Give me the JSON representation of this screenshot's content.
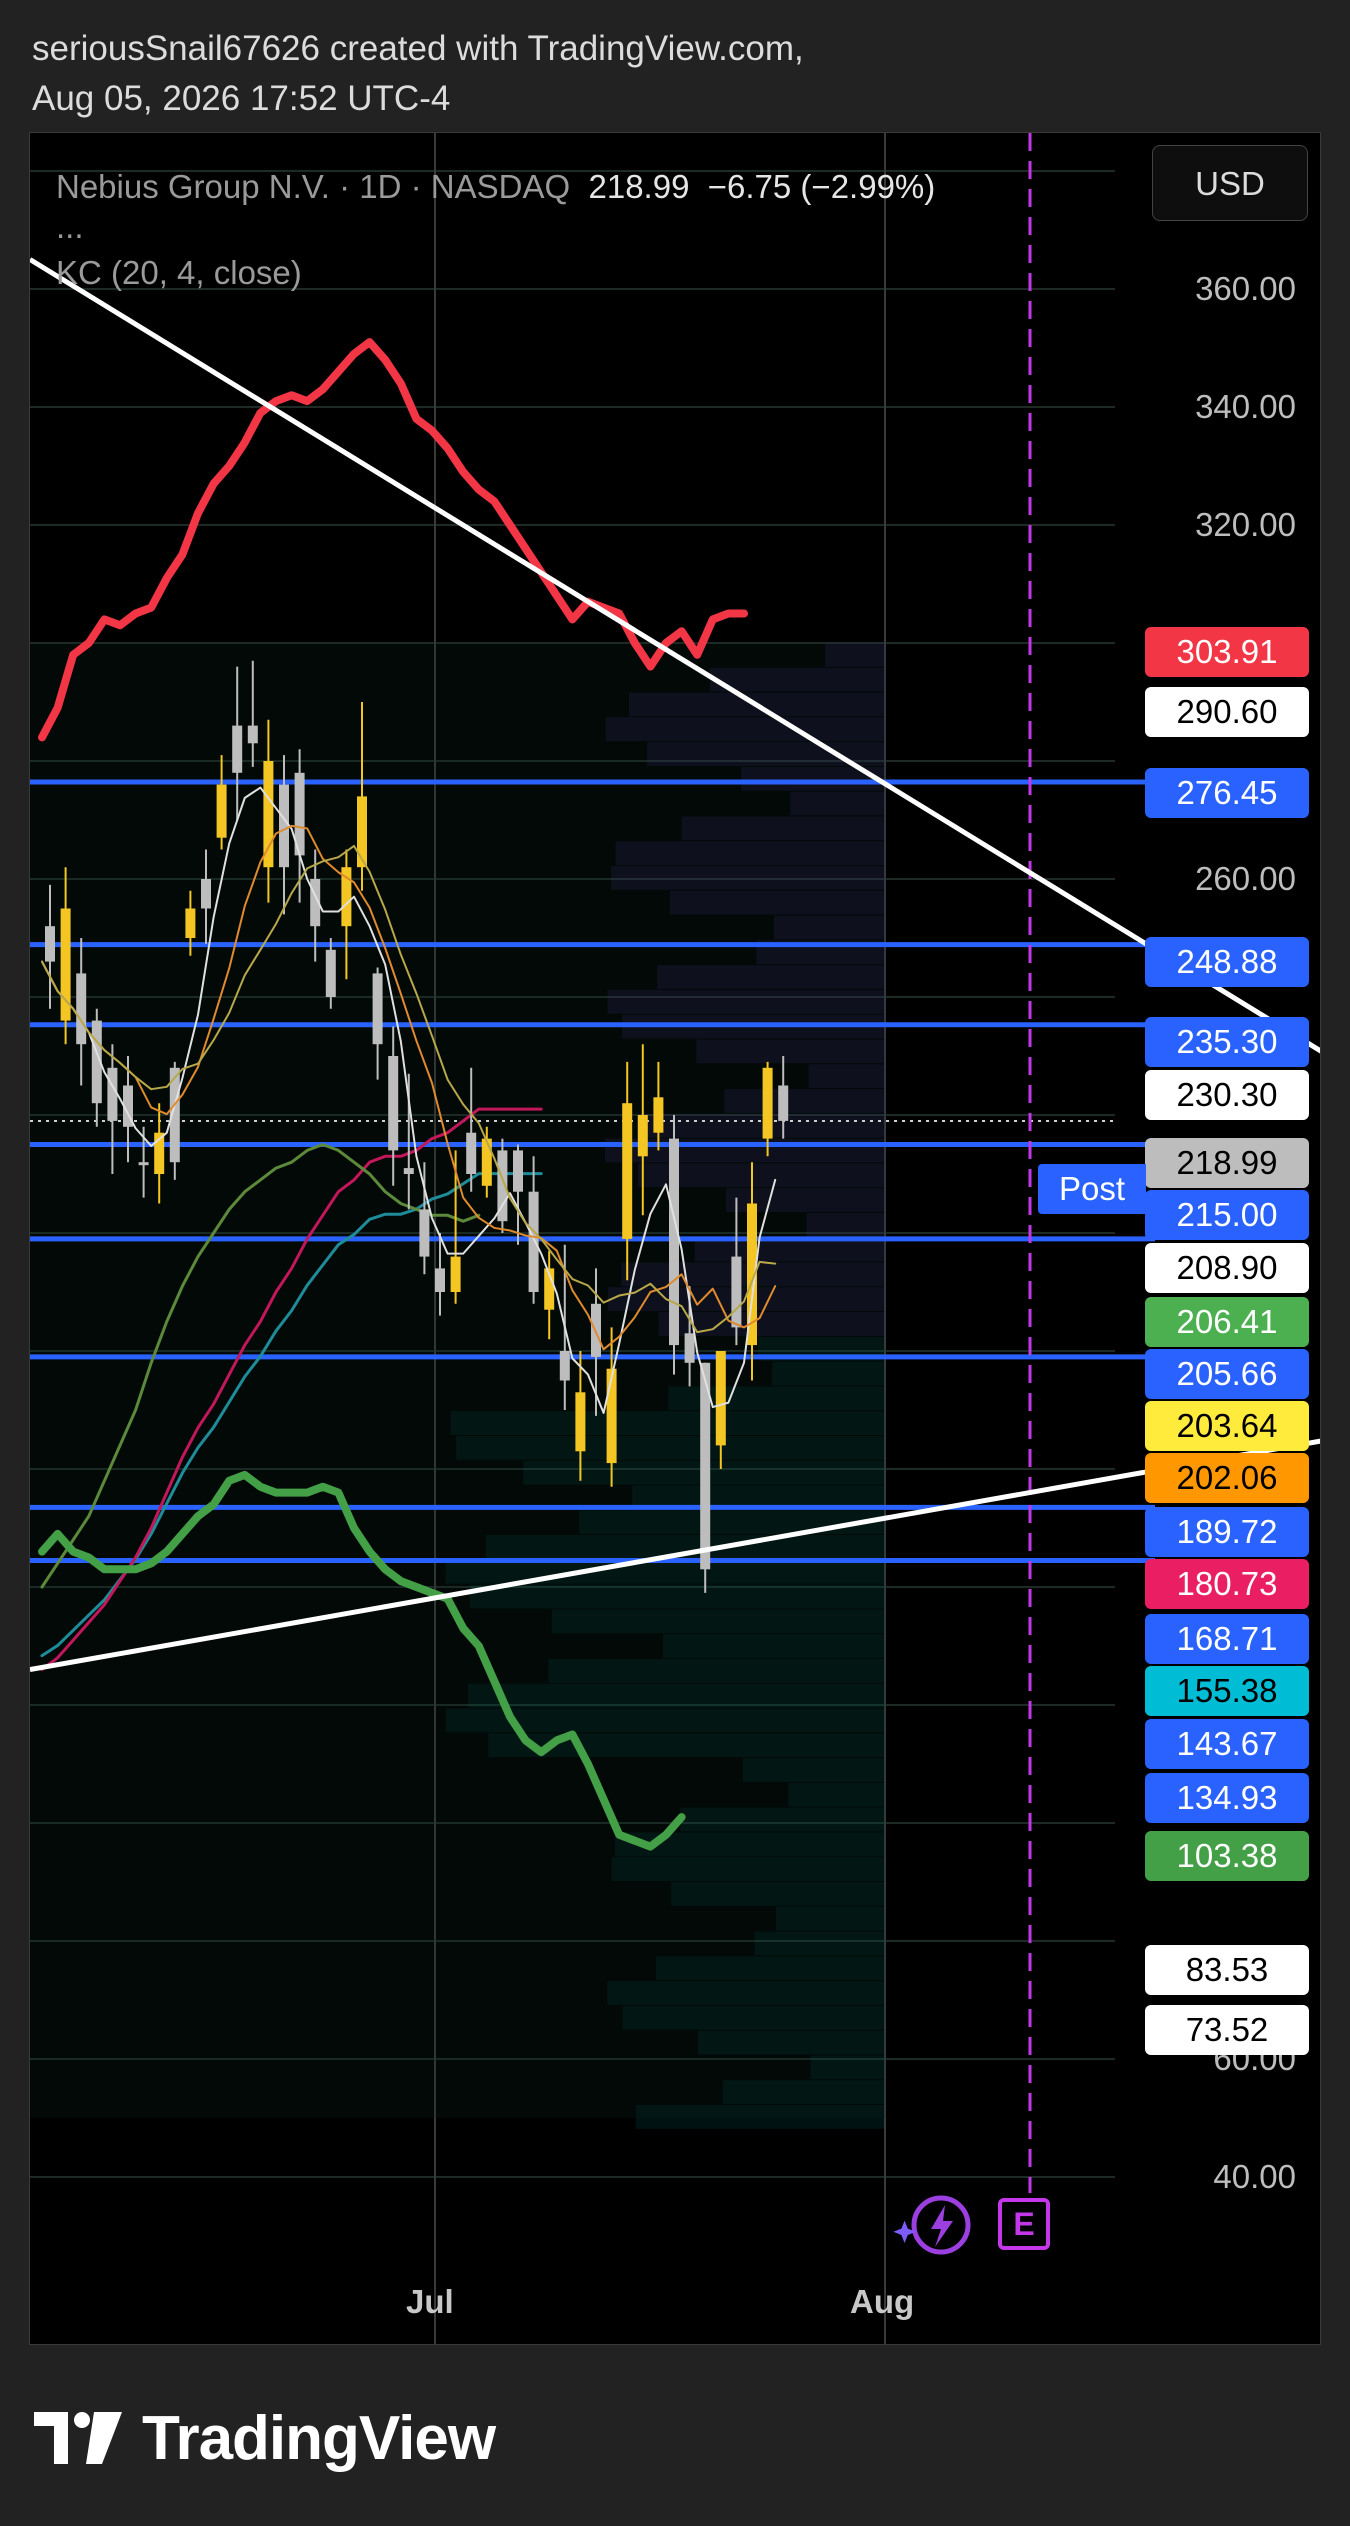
{
  "caption": {
    "line1": "seriousSnail67626 created with TradingView.com,",
    "line2": "Aug 05, 2026 17:52 UTC-4"
  },
  "header": {
    "symbol": "Nebius Group N.V. · 1D · NASDAQ",
    "price": "218.99",
    "change": "−6.75 (−2.99%)",
    "ellipsis": "...",
    "indicator": "KC (20, 4, close)",
    "currency": "USD"
  },
  "footer": {
    "brand": "TradingView"
  },
  "icons": {
    "lightning": "lightning-icon",
    "earnings": "earnings-icon",
    "logo": "tradingview-logo-icon"
  },
  "chart_data": {
    "type": "candlestick",
    "title": "",
    "ylim": [
      30,
      380
    ],
    "yticks": [
      "360.00",
      "340.00",
      "320.00",
      "260.00",
      "60.00",
      "40.00"
    ],
    "xticks": [
      "Jul",
      "Aug"
    ],
    "earnings_marker": "E",
    "post_label": "Post",
    "price_tags": [
      {
        "label": "303.91",
        "bg": "#f23645",
        "fg": "#ffffff"
      },
      {
        "label": "290.60",
        "bg": "#ffffff",
        "fg": "#000000"
      },
      {
        "label": "276.45",
        "bg": "#2962ff",
        "fg": "#ffffff"
      },
      {
        "label": "248.88",
        "bg": "#2962ff",
        "fg": "#ffffff"
      },
      {
        "label": "235.30",
        "bg": "#2962ff",
        "fg": "#ffffff"
      },
      {
        "label": "230.30",
        "bg": "#ffffff",
        "fg": "#000000"
      },
      {
        "label": "218.99",
        "bg": "#bdbdbd",
        "fg": "#000000"
      },
      {
        "label": "215.00",
        "bg": "#2962ff",
        "fg": "#ffffff"
      },
      {
        "label": "208.90",
        "bg": "#ffffff",
        "fg": "#000000"
      },
      {
        "label": "206.41",
        "bg": "#4caf50",
        "fg": "#ffffff"
      },
      {
        "label": "205.66",
        "bg": "#2962ff",
        "fg": "#ffffff"
      },
      {
        "label": "203.64",
        "bg": "#ffeb3b",
        "fg": "#000000"
      },
      {
        "label": "202.06",
        "bg": "#ff9800",
        "fg": "#000000"
      },
      {
        "label": "189.72",
        "bg": "#2962ff",
        "fg": "#ffffff"
      },
      {
        "label": "180.73",
        "bg": "#e91e63",
        "fg": "#ffffff"
      },
      {
        "label": "168.71",
        "bg": "#2962ff",
        "fg": "#ffffff"
      },
      {
        "label": "155.38",
        "bg": "#00bcd4",
        "fg": "#000000"
      },
      {
        "label": "143.67",
        "bg": "#2962ff",
        "fg": "#ffffff"
      },
      {
        "label": "134.93",
        "bg": "#2962ff",
        "fg": "#ffffff"
      },
      {
        "label": "103.38",
        "bg": "#43a047",
        "fg": "#ffffff"
      },
      {
        "label": "83.53",
        "bg": "#ffffff",
        "fg": "#000000"
      },
      {
        "label": "73.52",
        "bg": "#ffffff",
        "fg": "#000000"
      }
    ],
    "horizontal_levels": [
      276.45,
      248.88,
      235.3,
      215.0,
      199.0,
      179.0,
      153.5,
      144.5
    ],
    "last_price": 218.99,
    "post_price": 215.0,
    "trendlines": [
      {
        "from": [
          0,
          365
        ],
        "to": [
          112,
          178
        ]
      },
      {
        "from": [
          0,
          126
        ],
        "to": [
          112,
          180
        ]
      }
    ],
    "keltner_upper": [
      284,
      289,
      298,
      300,
      304,
      303,
      305,
      306,
      311,
      315,
      322,
      327,
      330,
      334,
      339,
      341,
      342,
      341,
      343,
      346,
      349,
      351,
      348,
      344,
      338,
      336,
      333,
      329,
      326,
      324,
      320,
      316,
      312,
      308,
      304,
      307,
      306,
      305,
      300,
      296,
      300,
      302,
      298,
      304,
      305,
      305
    ],
    "keltner_lower": [
      146,
      149,
      146,
      145,
      143,
      143,
      143,
      144,
      146,
      149,
      152,
      154,
      158,
      159,
      157,
      156,
      156,
      156,
      157,
      156,
      150,
      146,
      143,
      141,
      140,
      139,
      138,
      133,
      130,
      124,
      118,
      114,
      112,
      114,
      115,
      110,
      104,
      98,
      97,
      96,
      98,
      101
    ],
    "ema_slow": [
      126,
      128,
      131,
      134,
      137,
      141,
      145,
      150,
      156,
      162,
      167,
      171,
      176,
      181,
      185,
      190,
      194,
      199,
      203,
      207,
      209,
      212,
      213,
      213,
      214,
      216,
      217,
      219,
      221,
      221,
      221,
      221,
      221
    ],
    "ema_mid": [
      140,
      144,
      148,
      152,
      158,
      164,
      170,
      178,
      185,
      191,
      196,
      200,
      204,
      207,
      209,
      211,
      212,
      214,
      215,
      214,
      212,
      210,
      207,
      205,
      204,
      203,
      203,
      202,
      203
    ],
    "candles": [
      {
        "o": 252,
        "h": 259,
        "c": 246,
        "l": 238,
        "col": "gray"
      },
      {
        "o": 255,
        "h": 262,
        "c": 236,
        "l": 232,
        "col": "yellow"
      },
      {
        "o": 244,
        "h": 250,
        "c": 232,
        "l": 225,
        "col": "gray"
      },
      {
        "o": 236,
        "h": 238,
        "c": 222,
        "l": 218,
        "col": "gray"
      },
      {
        "o": 228,
        "h": 232,
        "c": 219,
        "l": 210,
        "col": "gray"
      },
      {
        "o": 225,
        "h": 230,
        "c": 218,
        "l": 212,
        "col": "gray"
      },
      {
        "o": 212,
        "h": 218,
        "c": 212,
        "l": 206,
        "col": "gray"
      },
      {
        "o": 217,
        "h": 222,
        "c": 210,
        "l": 205,
        "col": "yellow"
      },
      {
        "o": 212,
        "h": 229,
        "c": 228,
        "l": 209,
        "col": "gray"
      },
      {
        "o": 250,
        "h": 258,
        "c": 255,
        "l": 247,
        "col": "yellow"
      },
      {
        "o": 260,
        "h": 265,
        "c": 255,
        "l": 249,
        "col": "gray"
      },
      {
        "o": 267,
        "h": 281,
        "c": 276,
        "l": 265,
        "col": "yellow"
      },
      {
        "o": 286,
        "h": 296,
        "c": 278,
        "l": 270,
        "col": "gray"
      },
      {
        "o": 283,
        "h": 297,
        "c": 286,
        "l": 279,
        "col": "gray"
      },
      {
        "o": 280,
        "h": 287,
        "c": 262,
        "l": 256,
        "col": "yellow"
      },
      {
        "o": 276,
        "h": 281,
        "c": 262,
        "l": 254,
        "col": "gray"
      },
      {
        "o": 278,
        "h": 282,
        "c": 264,
        "l": 256,
        "col": "gray"
      },
      {
        "o": 260,
        "h": 265,
        "c": 252,
        "l": 246,
        "col": "gray"
      },
      {
        "o": 248,
        "h": 250,
        "c": 240,
        "l": 238,
        "col": "gray"
      },
      {
        "o": 252,
        "h": 265,
        "c": 262,
        "l": 243,
        "col": "yellow"
      },
      {
        "o": 262,
        "h": 290,
        "c": 274,
        "l": 258,
        "col": "yellow"
      },
      {
        "o": 244,
        "h": 245,
        "c": 232,
        "l": 226,
        "col": "gray"
      },
      {
        "o": 230,
        "h": 235,
        "c": 214,
        "l": 208,
        "col": "gray"
      },
      {
        "o": 211,
        "h": 227,
        "c": 210,
        "l": 204,
        "col": "gray"
      },
      {
        "o": 204,
        "h": 212,
        "c": 196,
        "l": 193,
        "col": "gray"
      },
      {
        "o": 194,
        "h": 200,
        "c": 190,
        "l": 186,
        "col": "gray"
      },
      {
        "o": 196,
        "h": 214,
        "c": 190,
        "l": 188,
        "col": "yellow"
      },
      {
        "o": 217,
        "h": 228,
        "c": 210,
        "l": 207,
        "col": "gray"
      },
      {
        "o": 216,
        "h": 218,
        "c": 208,
        "l": 206,
        "col": "yellow"
      },
      {
        "o": 214,
        "h": 216,
        "c": 202,
        "l": 200,
        "col": "gray"
      },
      {
        "o": 214,
        "h": 215,
        "c": 207,
        "l": 198,
        "col": "gray"
      },
      {
        "o": 207,
        "h": 213,
        "c": 190,
        "l": 188,
        "col": "gray"
      },
      {
        "o": 194,
        "h": 197,
        "c": 187,
        "l": 182,
        "col": "yellow"
      },
      {
        "o": 180,
        "h": 198,
        "c": 175,
        "l": 170,
        "col": "gray"
      },
      {
        "o": 173,
        "h": 180,
        "c": 163,
        "l": 158,
        "col": "yellow"
      },
      {
        "o": 188,
        "h": 194,
        "c": 179,
        "l": 169,
        "col": "gray"
      },
      {
        "o": 177,
        "h": 184,
        "c": 161,
        "l": 157,
        "col": "yellow"
      },
      {
        "o": 199,
        "h": 229,
        "c": 222,
        "l": 192,
        "col": "yellow"
      },
      {
        "o": 220,
        "h": 232,
        "c": 213,
        "l": 203,
        "col": "yellow"
      },
      {
        "o": 223,
        "h": 229,
        "c": 217,
        "l": 214,
        "col": "yellow"
      },
      {
        "o": 216,
        "h": 220,
        "c": 181,
        "l": 176,
        "col": "gray"
      },
      {
        "o": 183,
        "h": 191,
        "c": 178,
        "l": 174,
        "col": "gray"
      },
      {
        "o": 178,
        "h": 174,
        "c": 143,
        "l": 139,
        "col": "gray"
      },
      {
        "o": 164,
        "h": 172,
        "c": 180,
        "l": 160,
        "col": "yellow"
      },
      {
        "o": 196,
        "h": 206,
        "c": 184,
        "l": 181,
        "col": "gray"
      },
      {
        "o": 181,
        "h": 212,
        "c": 205,
        "l": 175,
        "col": "yellow"
      },
      {
        "o": 216,
        "h": 229,
        "c": 228,
        "l": 213,
        "col": "yellow"
      },
      {
        "o": 225,
        "h": 230,
        "c": 219,
        "l": 216,
        "col": "gray"
      }
    ]
  }
}
